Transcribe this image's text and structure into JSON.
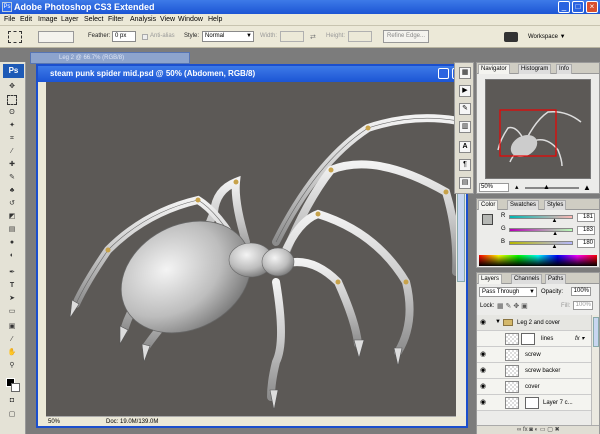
{
  "app": {
    "title": "Adobe Photoshop CS3 Extended",
    "logo": "Ps"
  },
  "menu": [
    "File",
    "Edit",
    "Image",
    "Layer",
    "Select",
    "Filter",
    "Analysis",
    "View",
    "Window",
    "Help"
  ],
  "options": {
    "feather_label": "Feather:",
    "feather_value": "0 px",
    "antialias_label": "Anti-alias",
    "style_label": "Style:",
    "style_value": "Normal",
    "width_label": "Width:",
    "height_label": "Height:",
    "refine_label": "Refine Edge...",
    "workspace_label": "Workspace"
  },
  "background_doc": {
    "title": "Leg 2 @ 66.7% (RGB/8)"
  },
  "document": {
    "title": "steam punk spider mid.psd @ 50% (Abdomen, RGB/8)",
    "zoom": "50%",
    "doc_info": "Doc: 19.0M/139.0M",
    "canvas_color": "#5c5956"
  },
  "navigator": {
    "tabs": [
      "Navigator",
      "Histogram",
      "Info"
    ],
    "zoom": "50%"
  },
  "color": {
    "tabs": [
      "Color",
      "Swatches",
      "Styles"
    ],
    "channels": [
      {
        "label": "R",
        "value": "181",
        "fraction": 0.71
      },
      {
        "label": "G",
        "value": "183",
        "fraction": 0.72
      },
      {
        "label": "B",
        "value": "180",
        "fraction": 0.71
      }
    ]
  },
  "layers": {
    "tabs": [
      "Layers",
      "Channels",
      "Paths"
    ],
    "blend_mode": "Pass Through",
    "opacity_label": "Opacity:",
    "opacity_value": "100%",
    "lock_label": "Lock:",
    "fill_label": "Fill:",
    "fill_value": "100%",
    "items": [
      {
        "name": "Leg 2 and cover"
      },
      {
        "name": "lines"
      },
      {
        "name": "screw"
      },
      {
        "name": "screw backer"
      },
      {
        "name": "cover"
      },
      {
        "name": "Layer 7 c..."
      }
    ]
  }
}
